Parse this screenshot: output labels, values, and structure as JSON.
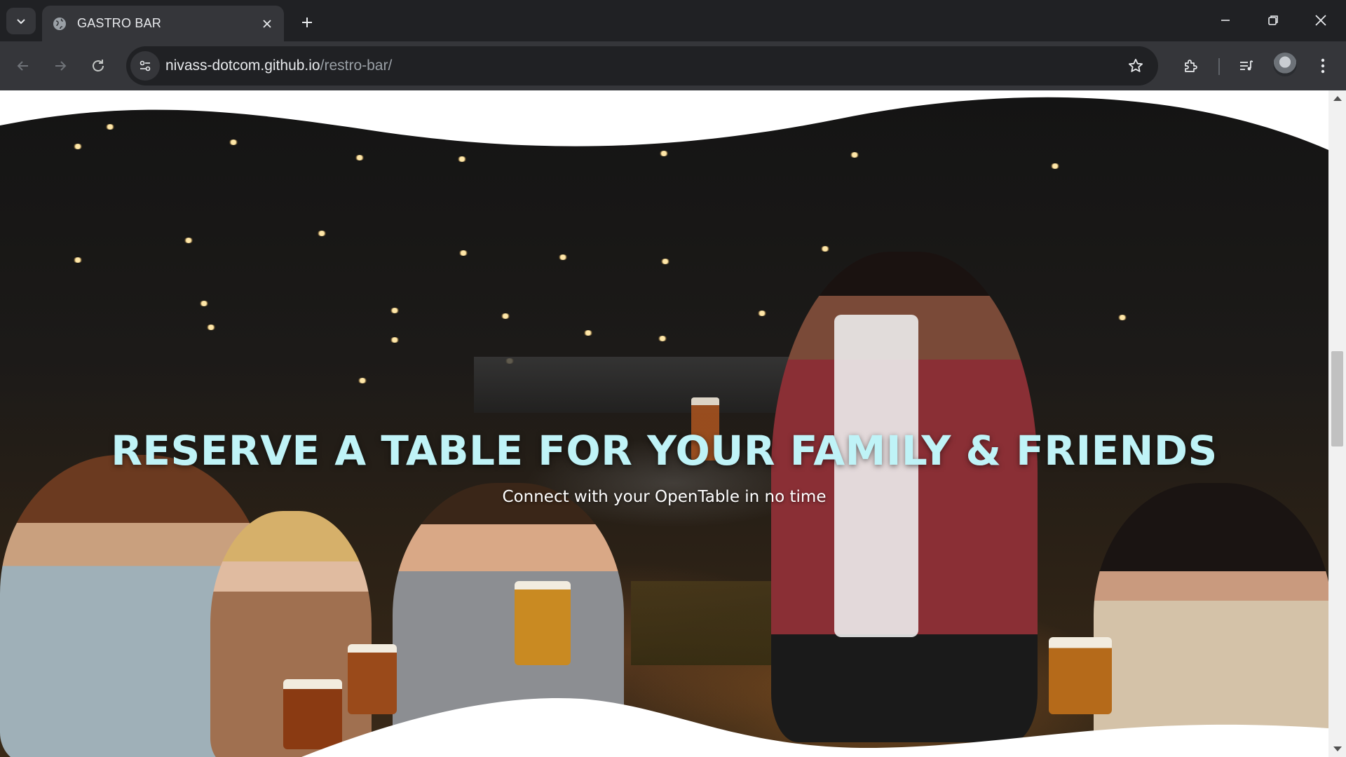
{
  "browser": {
    "tab_title": "GASTRO BAR",
    "url_host": "nivass-dotcom.github.io",
    "url_path": "/restro-bar/"
  },
  "hero": {
    "headline": "RESERVE A TABLE FOR YOUR FAMILY & FRIENDS",
    "subline": "Connect with your OpenTable in no time"
  },
  "colors": {
    "headline": "#bff3f7",
    "chrome_dark": "#202124",
    "chrome_mid": "#35363a"
  }
}
